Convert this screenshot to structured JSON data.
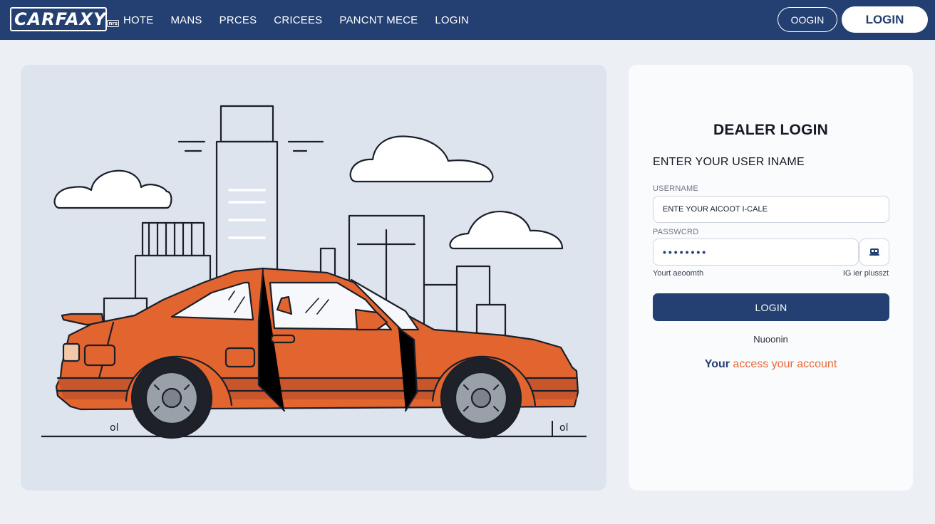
{
  "brand": {
    "logo_text": "CARFAXY",
    "logo_mark": "nrs"
  },
  "nav": {
    "items": [
      "HOTE",
      "MANS",
      "PRCES",
      "CRICEES",
      "PANCNT MECE",
      "LOGIN"
    ]
  },
  "header_actions": {
    "outline_label": "OOGIN",
    "solid_label": "LOGIN"
  },
  "illustration": {
    "subject": "orange-sedan-car",
    "ground_marks": [
      "ol",
      "ol"
    ]
  },
  "login": {
    "title": "DEALER LOGIN",
    "subtitle": "ENTER YOUR USER INAME",
    "username": {
      "label": "USERNAME",
      "value": "ENTE YOUR AICOOT I-CALE"
    },
    "password": {
      "label": "PASSWCRD",
      "value": "••••••••"
    },
    "note_left": "Yourt aeoomth",
    "note_right": "IG ier plusszt",
    "submit_label": "LOGIN",
    "secondary_text": "Nuoonin",
    "access_lead": "Your",
    "access_accent": "access your account"
  },
  "colors": {
    "header_bg": "#243f72",
    "car_body": "#e2642f",
    "accent": "#e8683a",
    "panel_bg": "#dde4ee"
  }
}
